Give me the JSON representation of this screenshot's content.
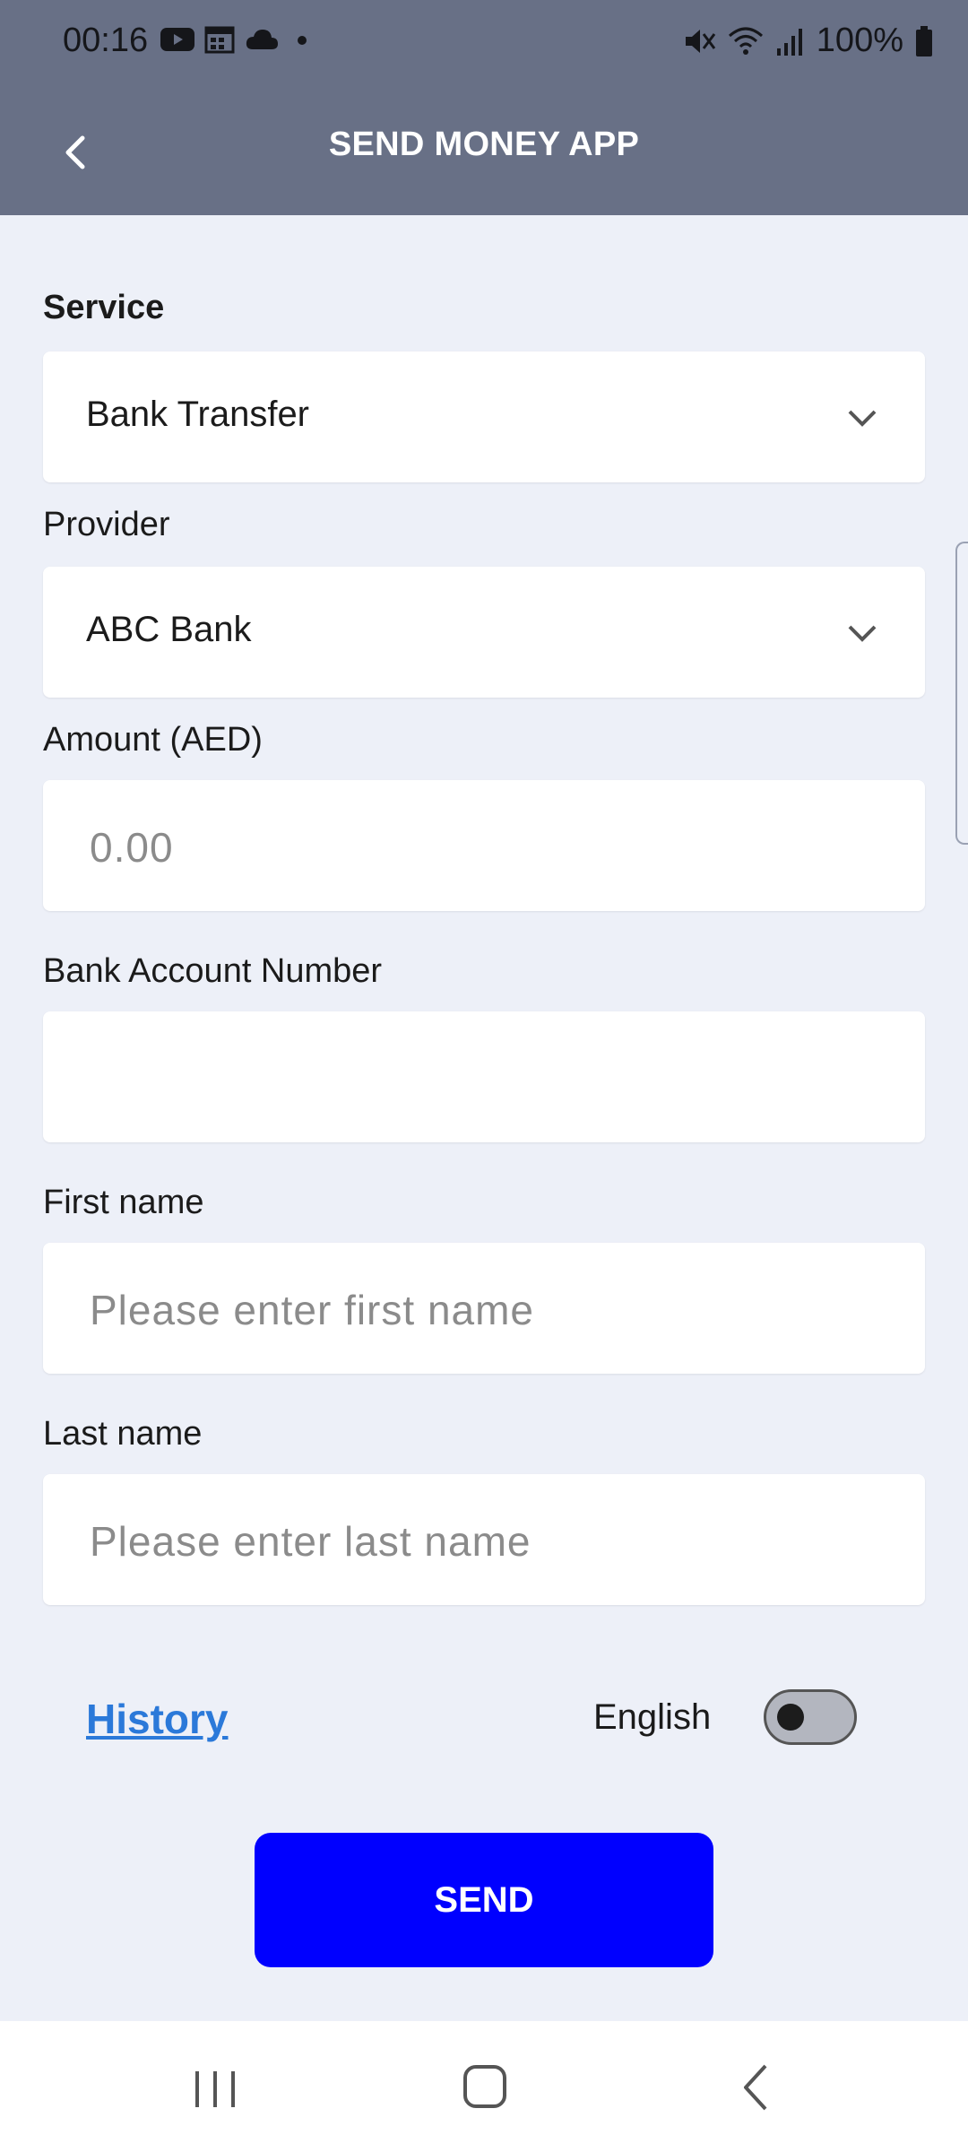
{
  "status": {
    "time": "00:16",
    "battery": "100%"
  },
  "appbar": {
    "title": "SEND MONEY APP"
  },
  "form": {
    "service": {
      "label": "Service",
      "value": "Bank Transfer"
    },
    "provider": {
      "label": "Provider",
      "value": "ABC Bank"
    },
    "amount": {
      "label": "Amount (AED)",
      "placeholder": "0.00"
    },
    "account": {
      "label": "Bank Account Number",
      "placeholder": ""
    },
    "first_name": {
      "label": "First name",
      "placeholder": "Please enter first name"
    },
    "last_name": {
      "label": "Last name",
      "placeholder": "Please enter last name"
    }
  },
  "footer": {
    "history_link": "History",
    "language_label": "English",
    "language_toggle_on": false
  },
  "actions": {
    "send_label": "SEND"
  },
  "colors": {
    "header": "#687086",
    "background": "#edf0f8",
    "primary_button": "#0000ff",
    "link": "#2b79d9"
  }
}
